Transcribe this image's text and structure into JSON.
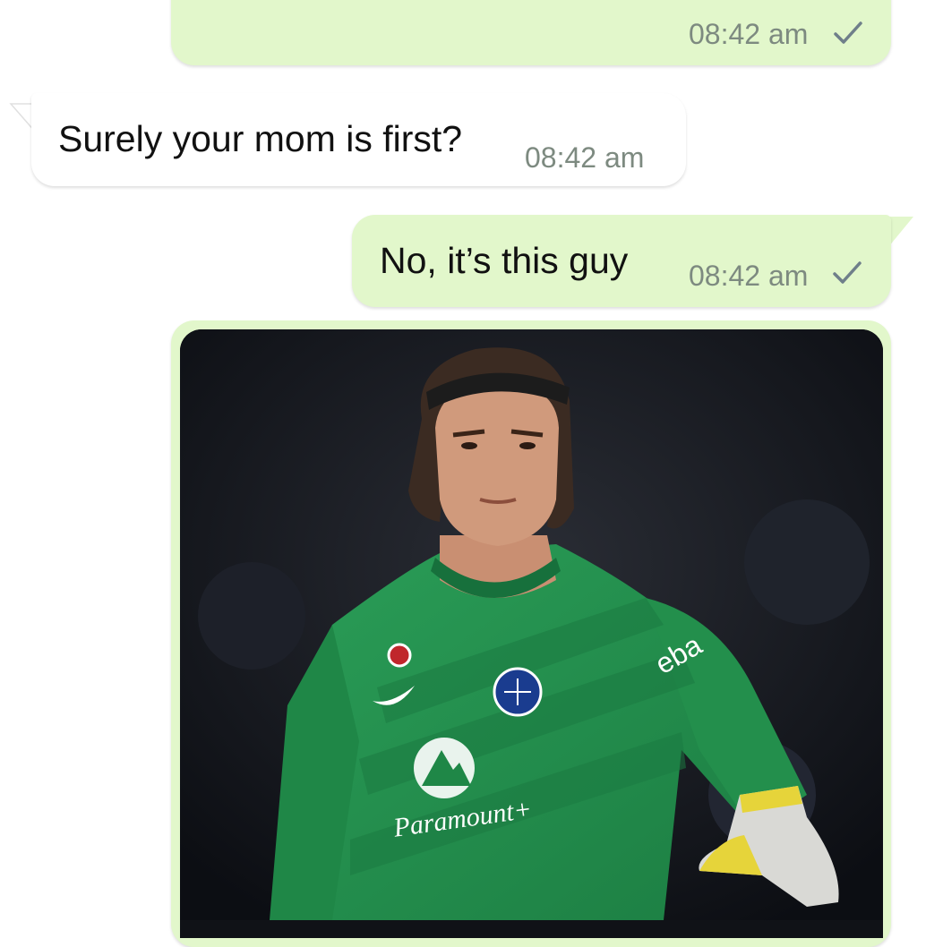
{
  "chat": {
    "messages": [
      {
        "direction": "outgoing",
        "text": "",
        "time": "08:42 am",
        "status": "sent-check-icon"
      },
      {
        "direction": "incoming",
        "text": "Surely your mom is first?",
        "time": "08:42 am"
      },
      {
        "direction": "outgoing",
        "text": "No, it’s this guy",
        "time": "08:42 am",
        "status": "sent-check-icon"
      },
      {
        "direction": "outgoing",
        "type": "image",
        "image": {
          "subject": "goalkeeper-photo",
          "jersey_text": "Paramount+",
          "sleeve_text": "eba"
        }
      }
    ]
  },
  "colors": {
    "outgoing_bubble": "#e2f7cb",
    "incoming_bubble": "#ffffff",
    "timestamp": "#7d8a80",
    "check": "#6f7f8a",
    "jersey_green": "#22924e"
  }
}
